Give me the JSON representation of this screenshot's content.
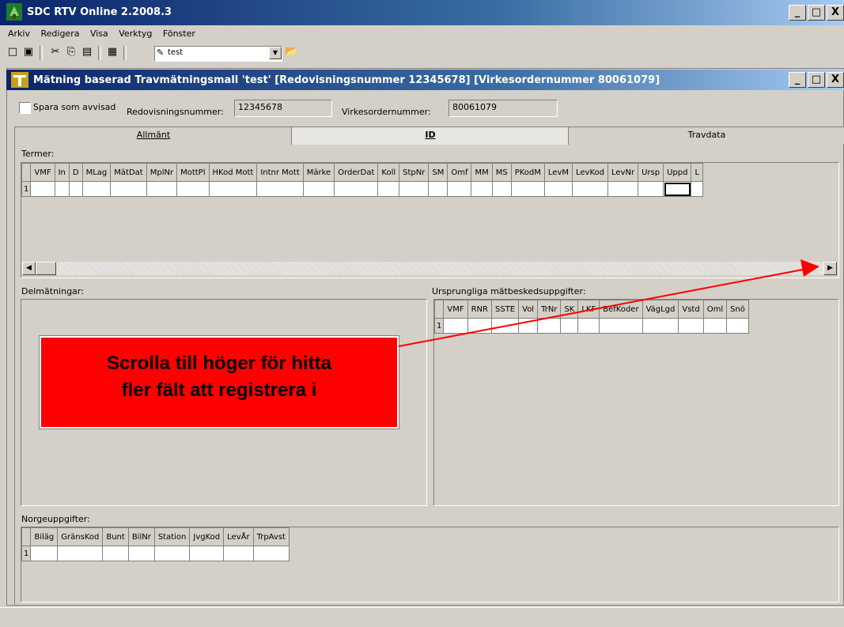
{
  "app": {
    "title": "SDC RTV Online 2.2008.3"
  },
  "window_buttons": {
    "minimize": "_",
    "maximize": "□",
    "close": "X"
  },
  "menu": [
    {
      "label": "Arkiv"
    },
    {
      "label": "Redigera"
    },
    {
      "label": "Visa"
    },
    {
      "label": "Verktyg"
    },
    {
      "label": "Fönster"
    }
  ],
  "toolbar": {
    "combo_value": "test"
  },
  "child_window": {
    "title": "Mätning baserad Travmätningsmall 'test' [Redovisningsnummer 12345678] [Virkesordernummer 80061079]"
  },
  "header": {
    "spara_label": "Spara som avvisad",
    "redov_label": "Redovisningsnummer:",
    "redov_value": "12345678",
    "virkes_label": "Virkesordernummer:",
    "virkes_value": "80061079"
  },
  "tabs": [
    {
      "label": "Allmänt",
      "active": false
    },
    {
      "label": "ID",
      "active": true
    },
    {
      "label": "Travdata",
      "active": false
    }
  ],
  "termer": {
    "label": "Termer:",
    "columns": [
      "VMF",
      "In",
      "D",
      "MLag",
      "MätDat",
      "MplNr",
      "MottPl",
      "HKod Mott",
      "Intnr Mott",
      "Märke",
      "OrderDat",
      "Koll",
      "StpNr",
      "SM",
      "Omf",
      "MM",
      "MS",
      "PKodM",
      "LevM",
      "LevKod",
      "LevNr",
      "Ursp",
      "Uppd",
      "L"
    ],
    "row_number": "1"
  },
  "delmatningar": {
    "label": "Delmätningar:"
  },
  "ursprungliga": {
    "label": "Ursprungliga mätbeskedsuppgifter:",
    "columns": [
      "VMF",
      "RNR",
      "SSTE",
      "Vol",
      "TrNr",
      "SK",
      "LKF",
      "BefKoder",
      "VägLgd",
      "Vstd",
      "Oml",
      "Snö"
    ],
    "row_number": "1"
  },
  "norge": {
    "label": "Norgeuppgifter:",
    "columns": [
      "Biläg",
      "GränsKod",
      "Bunt",
      "BilNr",
      "Station",
      "JvgKod",
      "LevÅr",
      "TrpAvst"
    ],
    "row_number": "1"
  },
  "callout": {
    "line1": "Scrolla till höger för hitta",
    "line2": "fler fält att registrera i",
    "color": "#ff0000"
  },
  "colors": {
    "titlebar": "#0a246a",
    "face": "#d4d0c8",
    "arrow": "#ff0000"
  }
}
